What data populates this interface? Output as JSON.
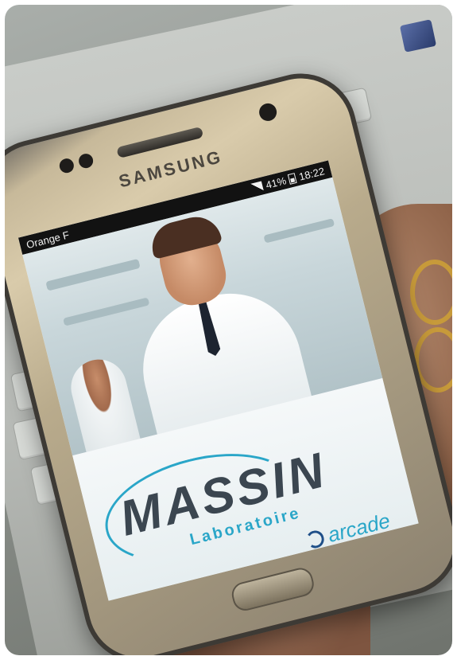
{
  "phone": {
    "brand": "SAMSUNG",
    "status_bar": {
      "carrier": "Orange F",
      "battery": "41%",
      "time": "18:22"
    },
    "app_splash": {
      "logo_text": "MASSIN",
      "logo_subtitle": "Laboratoire",
      "partner_text": "arcade"
    }
  },
  "colors": {
    "accent": "#2aa6c8",
    "logo_dark": "#3b4650",
    "status_bar_bg": "#121212"
  }
}
